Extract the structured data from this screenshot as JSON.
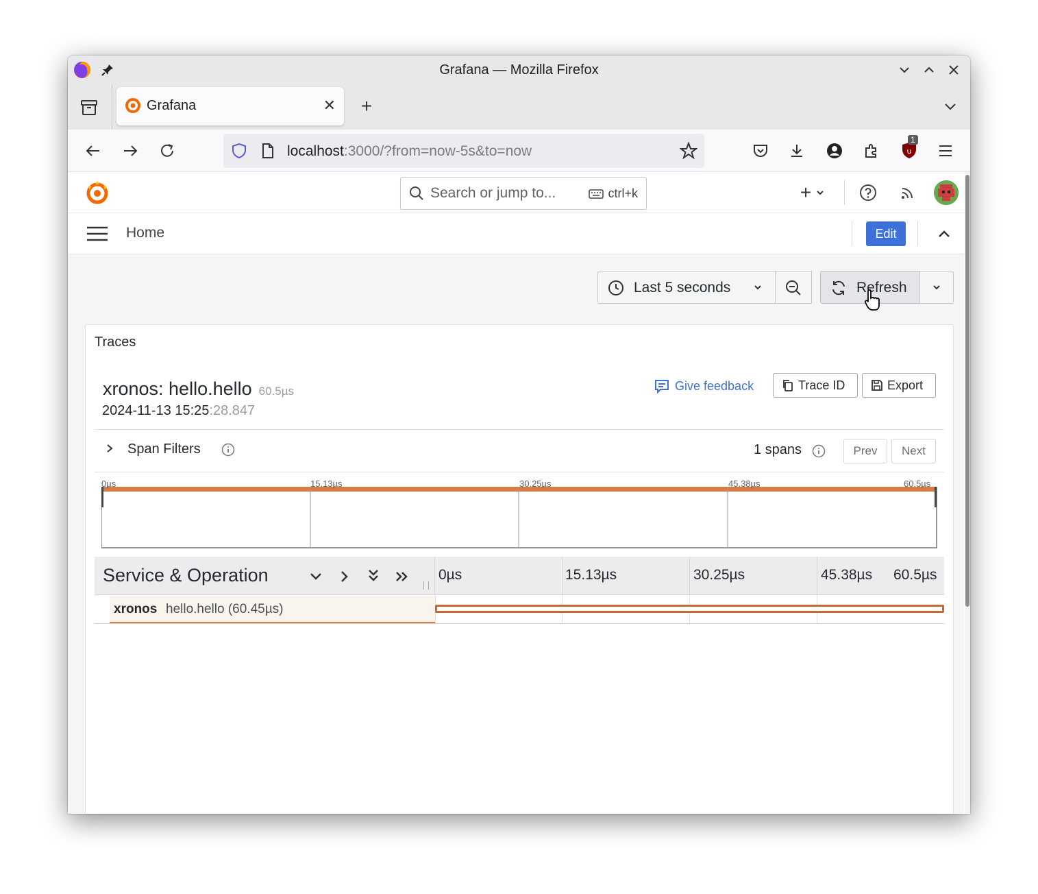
{
  "browser": {
    "window_title": "Grafana — Mozilla Firefox",
    "tab_title": "Grafana",
    "url_host": "localhost",
    "url_rest": ":3000/?from=now-5s&to=now",
    "extension_badge": "1"
  },
  "grafana": {
    "search_placeholder": "Search or jump to...",
    "search_shortcut": "ctrl+k",
    "breadcrumb": "Home",
    "edit_label": "Edit",
    "time_range": "Last 5 seconds",
    "refresh_label": "Refresh"
  },
  "panel": {
    "title": "Traces",
    "trace_service": "xronos: hello.hello",
    "trace_duration": "60.5µs",
    "trace_date": "2024-11-13 15:25",
    "trace_date_ms": ":28.847",
    "give_feedback": "Give feedback",
    "trace_id_label": "Trace ID",
    "export_label": "Export",
    "span_filters": "Span Filters",
    "spans_count": "1 spans",
    "prev_label": "Prev",
    "next_label": "Next"
  },
  "minimap_ticks": [
    "0µs",
    "15.13µs",
    "30.25µs",
    "45.38µs",
    "60.5µs"
  ],
  "timeline": {
    "header": "Service & Operation",
    "ticks": [
      "0µs",
      "15.13µs",
      "30.25µs",
      "45.38µs",
      "60.5µs"
    ],
    "spans": [
      {
        "service": "xronos",
        "operation": "hello.hello (60.45µs)",
        "start_fraction": 0.0,
        "duration_fraction": 1.0
      }
    ]
  },
  "colors": {
    "span_accent": "#d67c45",
    "primary_button": "#3d71d9"
  }
}
